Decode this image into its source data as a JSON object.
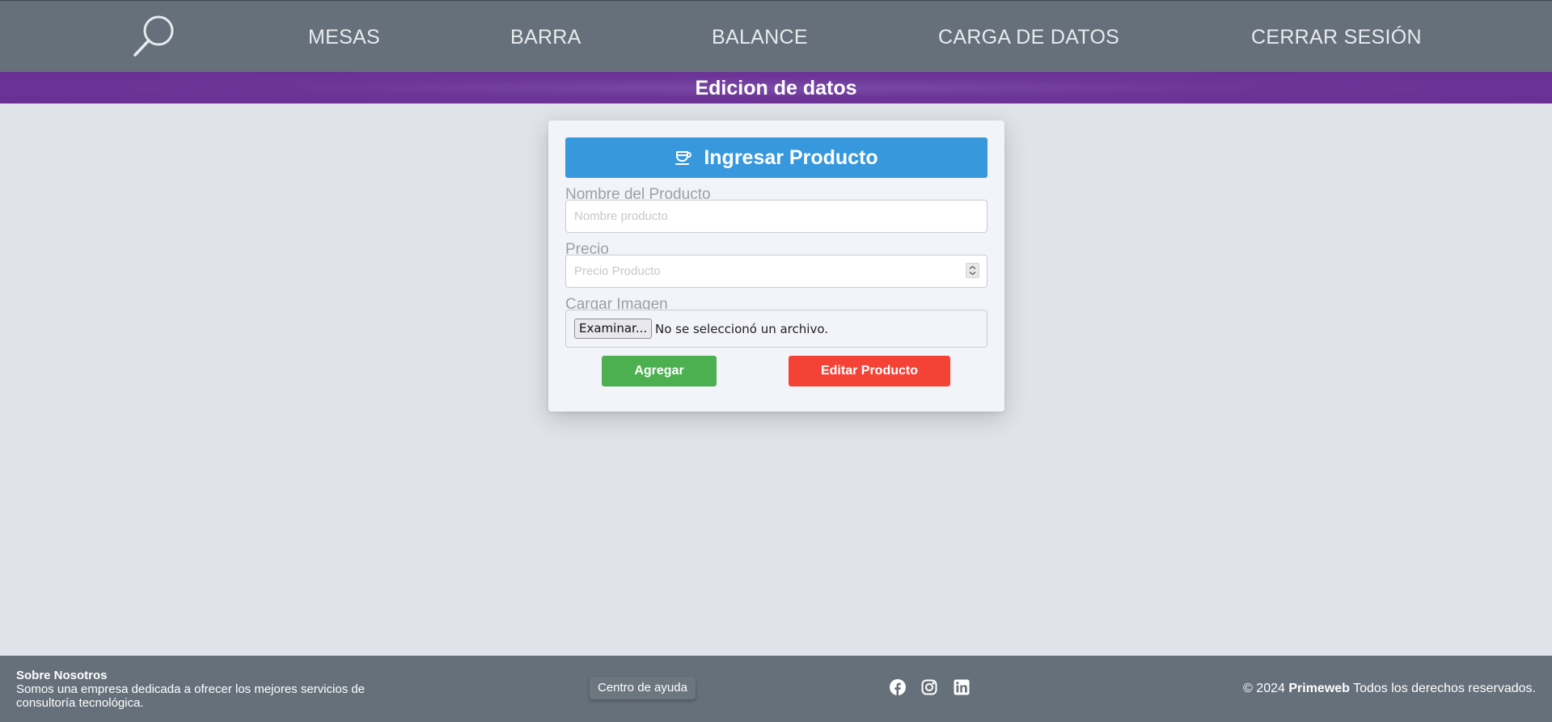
{
  "nav": {
    "search_icon": "search-icon",
    "items": [
      "MESAS",
      "BARRA",
      "BALANCE",
      "CARGA DE DATOS",
      "CERRAR SESIÓN"
    ]
  },
  "title_bar": {
    "text": "Edicion de datos",
    "color": "#6c3596"
  },
  "form": {
    "header": "Ingresar Producto",
    "header_icon": "coffee-cup-icon",
    "name_label": "Nombre del Producto",
    "name_placeholder": "Nombre producto",
    "name_value": "",
    "price_label": "Precio",
    "price_placeholder": "Precio Producto",
    "price_value": "",
    "image_label": "Cargar Imagen",
    "file_button": "Examinar...",
    "file_status": "No se seleccionó un archivo.",
    "add_button": "Agregar",
    "edit_button": "Editar Producto",
    "colors": {
      "header": "#3798de",
      "add": "#4caf50",
      "edit": "#f44336"
    }
  },
  "footer": {
    "about_title": "Sobre Nosotros",
    "about_text": "Somos una empresa dedicada a ofrecer los mejores servicios de consultoría tecnológica.",
    "help": "Centro de ayuda",
    "social_icons": [
      "facebook-icon",
      "instagram-icon",
      "linkedin-icon"
    ],
    "copyright_prefix": "© 2024",
    "brand": "Primeweb",
    "copyright_suffix": "Todos los derechos reservados."
  }
}
